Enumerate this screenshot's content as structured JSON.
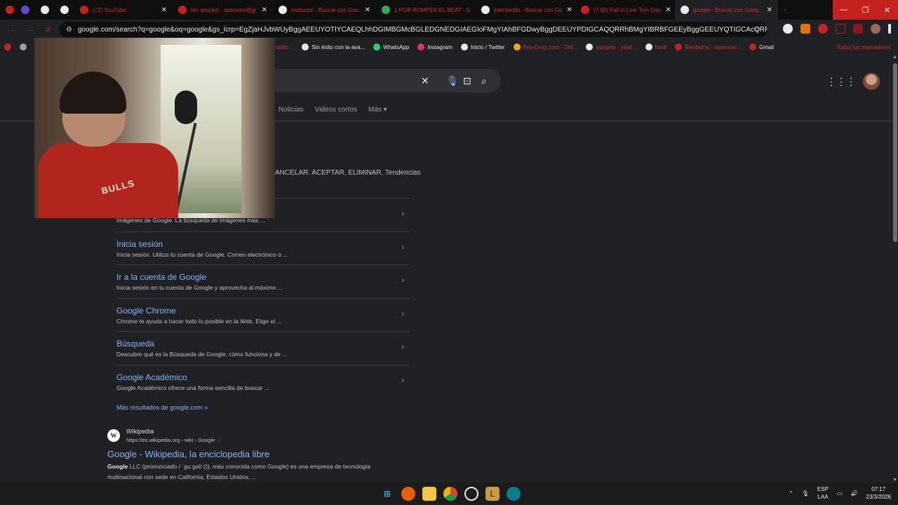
{
  "browser": {
    "tabs": [
      {
        "label": "",
        "fav_color": "#c5221f"
      },
      {
        "label": "",
        "fav_color": "#5b4bd1"
      },
      {
        "label": "",
        "fav_color": "#e8eaed"
      },
      {
        "label": "",
        "fav_color": "#e8eaed"
      },
      {
        "label": "(72) YouTube",
        "fav_color": "#c5221f"
      },
      {
        "label": "ten anunkd - xpanvow@gr",
        "fav_color": "#c5221f"
      },
      {
        "label": "traductor - Buscar con Goo",
        "fav_color": "#e8eaed"
      },
      {
        "label": "1 POR ROMPER EL BEAT - G",
        "fav_color": "#34a853"
      },
      {
        "label": "intentando - Buscar con Go",
        "fav_color": "#e8eaed"
      },
      {
        "label": "(7:00) Fall in Line Tom Gan",
        "fav_color": "#c5221f"
      },
      {
        "label": "google - Buscar con Goog",
        "fav_color": "#e8eaed"
      }
    ],
    "address": "google.com/search?q=google&oq=google&gs_lcrp=EgZjaHJvbWUyBggAEEUYOTIYCAEQLhhDGIMBGMcBGLEDGNEDGIAEGIoFMgYIAhBFGDwyBggDEEUYPDIGCAQQRRhBMgYIBRBFGEEyBggGEEUYQTIGCAcQRRg80gEIMTEzOWowaj...",
    "bookmarks": [
      {
        "label": "",
        "fav_color": "#c5221f"
      },
      {
        "label": "",
        "fav_color": "#9aa0a6"
      },
      {
        "label": "ore la analític...",
        "fav_color": "#c5221f"
      },
      {
        "label": "Sin éxito con la ava...",
        "fav_color": "#e8eaed"
      },
      {
        "label": "WhatsApp",
        "fav_color": "#25d366"
      },
      {
        "label": "Instagram",
        "fav_color": "#e1306c"
      },
      {
        "label": "Inicio / Twitter",
        "fav_color": "#e8eaed"
      },
      {
        "label": "Key-Drop.com - Onl...",
        "fav_color": "#f9ab00"
      },
      {
        "label": "vampiro - yesit...",
        "fav_color": "#e8eaed"
      },
      {
        "label": "Nodi",
        "fav_color": "#e8eaed"
      },
      {
        "label": "Recibidos - xpanvow...",
        "fav_color": "#c5221f"
      },
      {
        "label": "Gmail",
        "fav_color": "#c5221f"
      }
    ],
    "all_bookmarks": "Todos los marcadores"
  },
  "google": {
    "tabs": [
      "Noticias",
      "Videos cortos",
      "Más"
    ],
    "snippet_top": "ANCELAR. ACEPTAR. ELIMINAR. Tendencias",
    "first_desc": "Imágenes de Google. La búsqueda de imágenes más ...",
    "sitelinks": [
      {
        "title": "",
        "desc": ""
      },
      {
        "title": "Inicia sesión",
        "desc": "Inicia sesión. Utiliza tu cuenta de Google. Correo electrónico o ..."
      },
      {
        "title": "Ir a la cuenta de Google",
        "desc": "Inicia sesión en tu cuenta de Google y aprovecha al máximo ..."
      },
      {
        "title": "Google Chrome",
        "desc": "Chrome te ayuda a hacer todo lo posible en la Web. Elige el ..."
      },
      {
        "title": "Búsqueda",
        "desc": "Descubre qué es la Búsqueda de Google, cómo funciona y de ..."
      },
      {
        "title": "Google Académico",
        "desc": "Google Académico ofrece una forma sencilla de buscar ..."
      }
    ],
    "more_results": "Más resultados de google.com »",
    "wiki": {
      "logo": "W",
      "site": "Wikipedia",
      "url": "https://es.wikipedia.org › wiki › Google",
      "title": "Google - Wikipedia, la enciclopedia libre",
      "desc_bold": "Google",
      "desc_rest": " LLC (pronunciado / ˈɡuːɡəl/ ()), más conocida como Google) es una empresa de tecnología multinacional con sede en California, Estados Unidos, ..."
    }
  },
  "webcam": {
    "jersey_text": "BULLS"
  },
  "taskbar": {
    "lang_top": "ESP",
    "lang_bottom": "LAA",
    "time": "07:17",
    "date": "23/3/2026"
  }
}
